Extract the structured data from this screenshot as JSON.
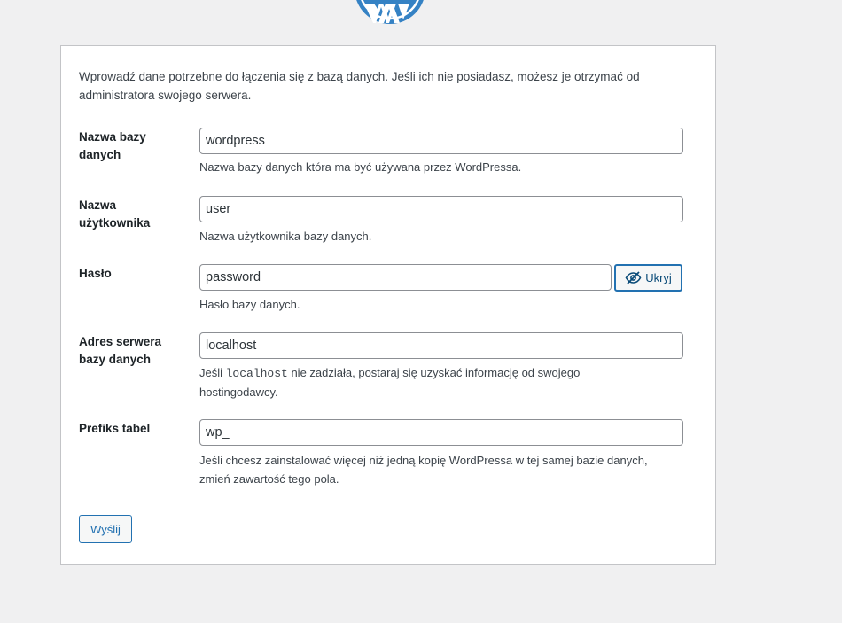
{
  "colors": {
    "background": "#f0f0f1",
    "card": "#ffffff",
    "accent": "#2271b1",
    "logo": "#3582c4"
  },
  "logo_icon": "wordpress-logo-icon",
  "intro": "Wprowadź dane potrzebne do łączenia się z bazą danych. Jeśli ich nie posiadasz, możesz je otrzymać od administratora swojego serwera.",
  "fields": {
    "dbname": {
      "label": "Nazwa bazy danych",
      "value": "wordpress",
      "description": "Nazwa bazy danych która ma być używana przez WordPressa."
    },
    "username": {
      "label": "Nazwa użytkownika",
      "value": "user",
      "description": "Nazwa użytkownika bazy danych."
    },
    "password": {
      "label": "Hasło",
      "value": "password",
      "description": "Hasło bazy danych.",
      "toggle_label": "Ukryj",
      "toggle_icon": "eye-slash-icon"
    },
    "dbhost": {
      "label": "Adres serwera bazy danych",
      "value": "localhost",
      "description_before": "Jeśli ",
      "description_code": "localhost",
      "description_after": " nie zadziała, postaraj się uzyskać informację od swojego hostingodawcy."
    },
    "prefix": {
      "label": "Prefiks tabel",
      "value": "wp_",
      "description": "Jeśli chcesz zainstalować więcej niż jedną kopię WordPressa w tej samej bazie danych, zmień zawartość tego pola."
    }
  },
  "submit_label": "Wyślij"
}
